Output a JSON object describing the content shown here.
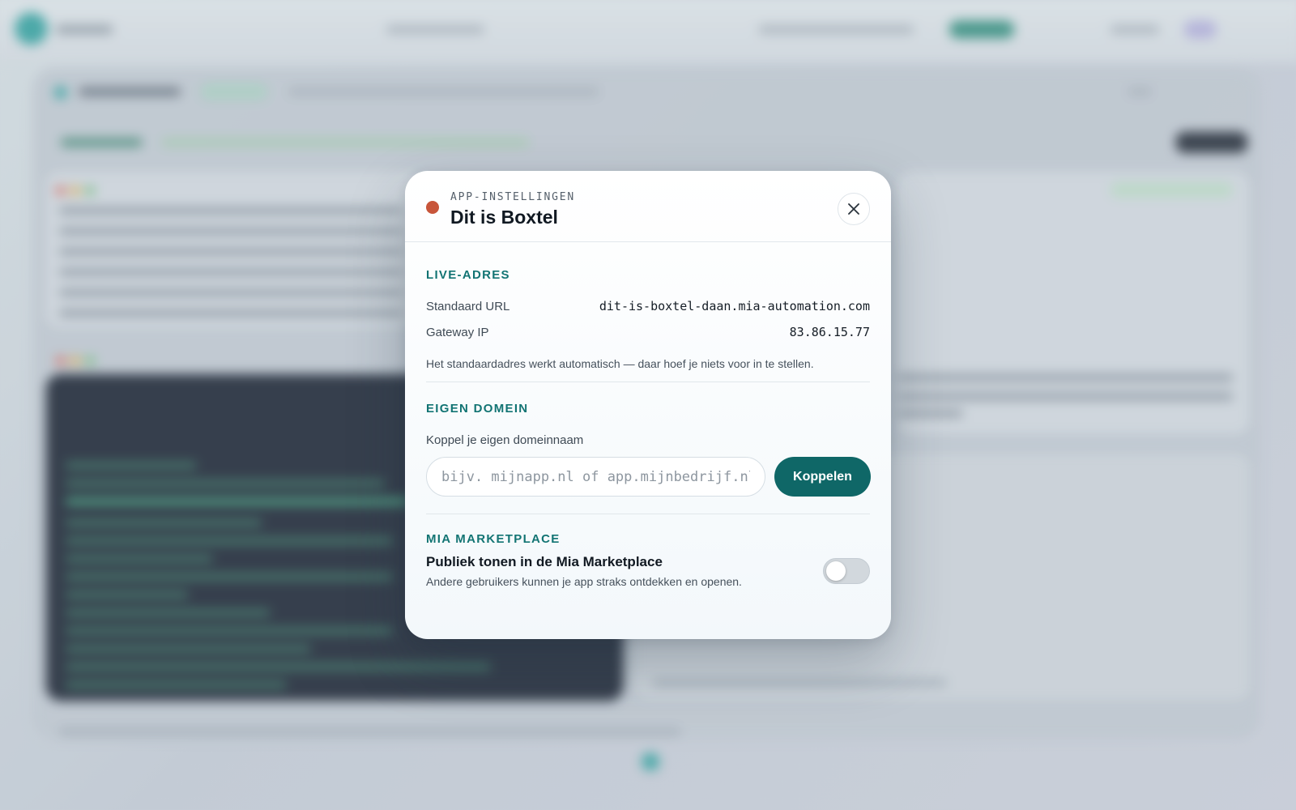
{
  "modal": {
    "eyebrow": "APP-INSTELLINGEN",
    "title": "Dit is Boxtel",
    "status_color": "#c8553a",
    "close_icon": "close-icon"
  },
  "live_address": {
    "heading": "LIVE-ADRES",
    "rows": [
      {
        "label": "Standaard URL",
        "value": "dit-is-boxtel-daan.mia-automation.com"
      },
      {
        "label": "Gateway IP",
        "value": "83.86.15.77"
      }
    ],
    "note": "Het standaardadres werkt automatisch — daar hoef je niets voor in te stellen."
  },
  "custom_domain": {
    "heading": "EIGEN DOMEIN",
    "field_label": "Koppel je eigen domeinnaam",
    "input_value": "",
    "input_placeholder": "bijv. mijnapp.nl of app.mijnbedrijf.nl",
    "button_label": "Koppelen"
  },
  "marketplace": {
    "heading": "MIA MARKETPLACE",
    "toggle_title": "Publiek tonen in de Mia Marketplace",
    "toggle_description": "Andere gebruikers kunnen je app straks ontdekken en openen.",
    "toggle_on": false
  },
  "colors": {
    "accent": "#127473",
    "button": "#0f6767",
    "status_dot": "#c8553a"
  }
}
